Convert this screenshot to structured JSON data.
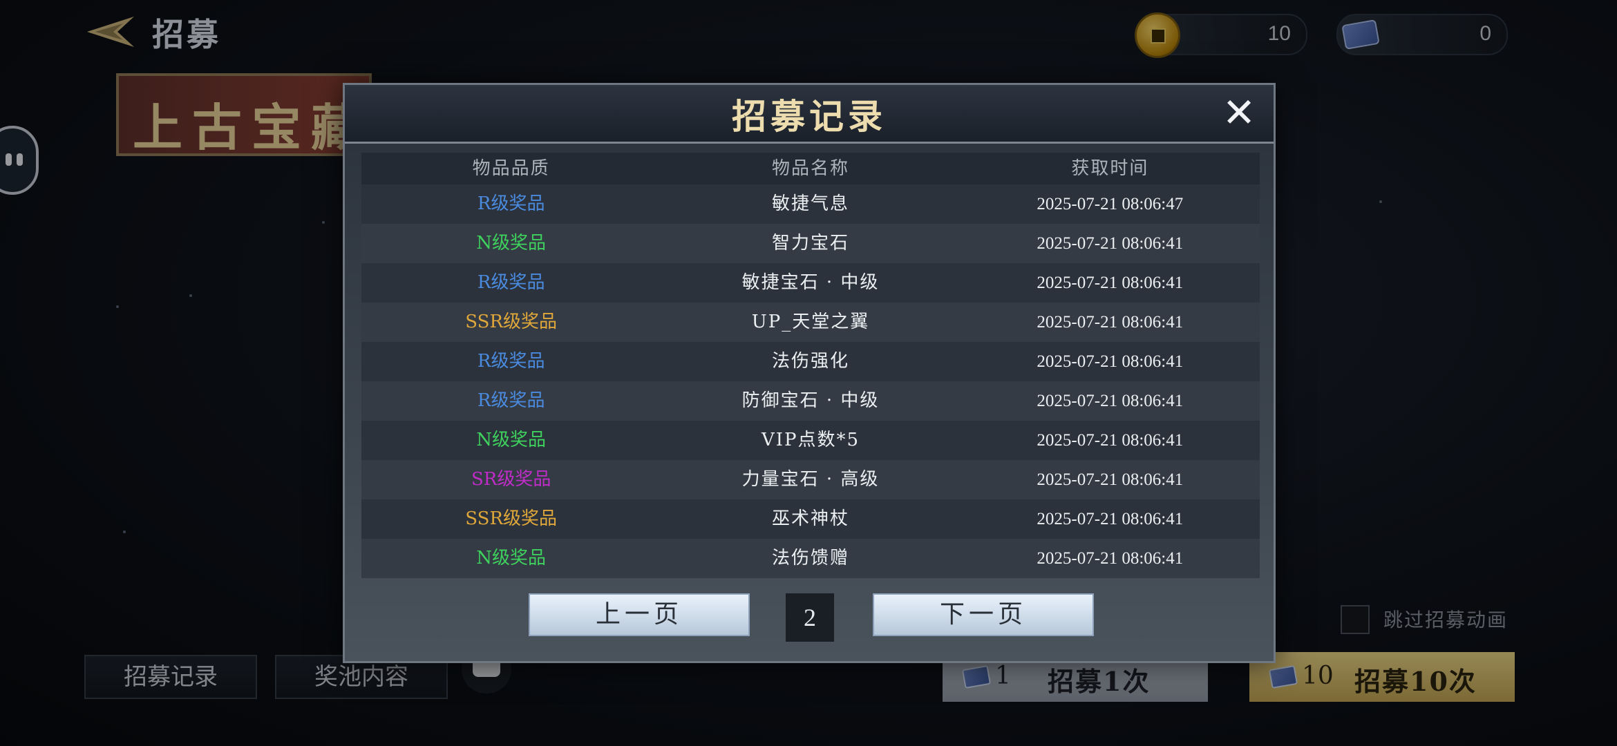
{
  "header": {
    "title": "招募"
  },
  "currencies": {
    "coins": "10",
    "tickets": "0"
  },
  "banner": {
    "text": "上古宝藏"
  },
  "bottom": {
    "record_label": "招募记录",
    "pool_label": "奖池内容",
    "skip_label": "跳过招募动画",
    "recruit_one": {
      "count": "1",
      "label": "招募1次"
    },
    "recruit_ten": {
      "count": "10",
      "label": "招募10次"
    }
  },
  "modal": {
    "title": "招募记录",
    "columns": [
      "物品品质",
      "物品名称",
      "获取时间"
    ],
    "rows": [
      {
        "quality": "R级奖品",
        "name": "敏捷气息",
        "time": "2025-07-21 08:06:47"
      },
      {
        "quality": "N级奖品",
        "name": "智力宝石",
        "time": "2025-07-21 08:06:41"
      },
      {
        "quality": "R级奖品",
        "name": "敏捷宝石 · 中级",
        "time": "2025-07-21 08:06:41"
      },
      {
        "quality": "SSR级奖品",
        "name": "UP_天堂之翼",
        "time": "2025-07-21 08:06:41"
      },
      {
        "quality": "R级奖品",
        "name": "法伤强化",
        "time": "2025-07-21 08:06:41"
      },
      {
        "quality": "R级奖品",
        "name": "防御宝石 · 中级",
        "time": "2025-07-21 08:06:41"
      },
      {
        "quality": "N级奖品",
        "name": "VIP点数*5",
        "time": "2025-07-21 08:06:41"
      },
      {
        "quality": "SR级奖品",
        "name": "力量宝石 · 高级",
        "time": "2025-07-21 08:06:41"
      },
      {
        "quality": "SSR级奖品",
        "name": "巫术神杖",
        "time": "2025-07-21 08:06:41"
      },
      {
        "quality": "N级奖品",
        "name": "法伤馈赠",
        "time": "2025-07-21 08:06:41"
      }
    ],
    "prev_label": "上一页",
    "next_label": "下一页",
    "page": "2"
  },
  "colors": {
    "R": "#4a8be0",
    "N": "#3fd15e",
    "SSR": "#e0a83a",
    "SR": "#c02cc8",
    "title_gold": "#ecdcae"
  }
}
